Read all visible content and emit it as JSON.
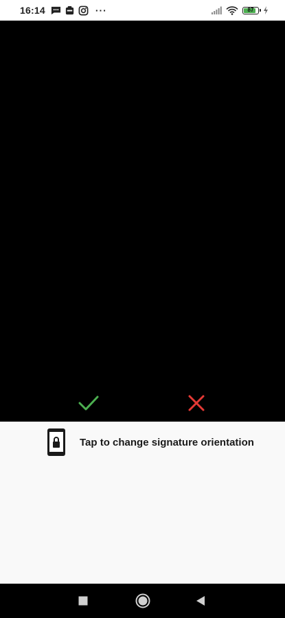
{
  "status_bar": {
    "time": "16:14",
    "left_icons": [
      "message-icon",
      "app-notification-icon",
      "instagram-icon"
    ],
    "more": "···",
    "right_icons": [
      "signal-icon",
      "wifi-icon",
      "battery-icon",
      "charging-icon"
    ],
    "battery_level": "87",
    "battery_fraction": 0.87
  },
  "signature": {
    "background_color": "#000000",
    "confirm_icon": "check-icon",
    "confirm_color": "#4caf50",
    "cancel_icon": "close-icon",
    "cancel_color": "#e53935"
  },
  "orientation": {
    "icon": "phone-lock-icon",
    "label": "Tap to change signature orientation"
  },
  "nav_bar": {
    "recents_icon": "square-icon",
    "home_icon": "circle-icon",
    "back_icon": "triangle-back-icon"
  }
}
